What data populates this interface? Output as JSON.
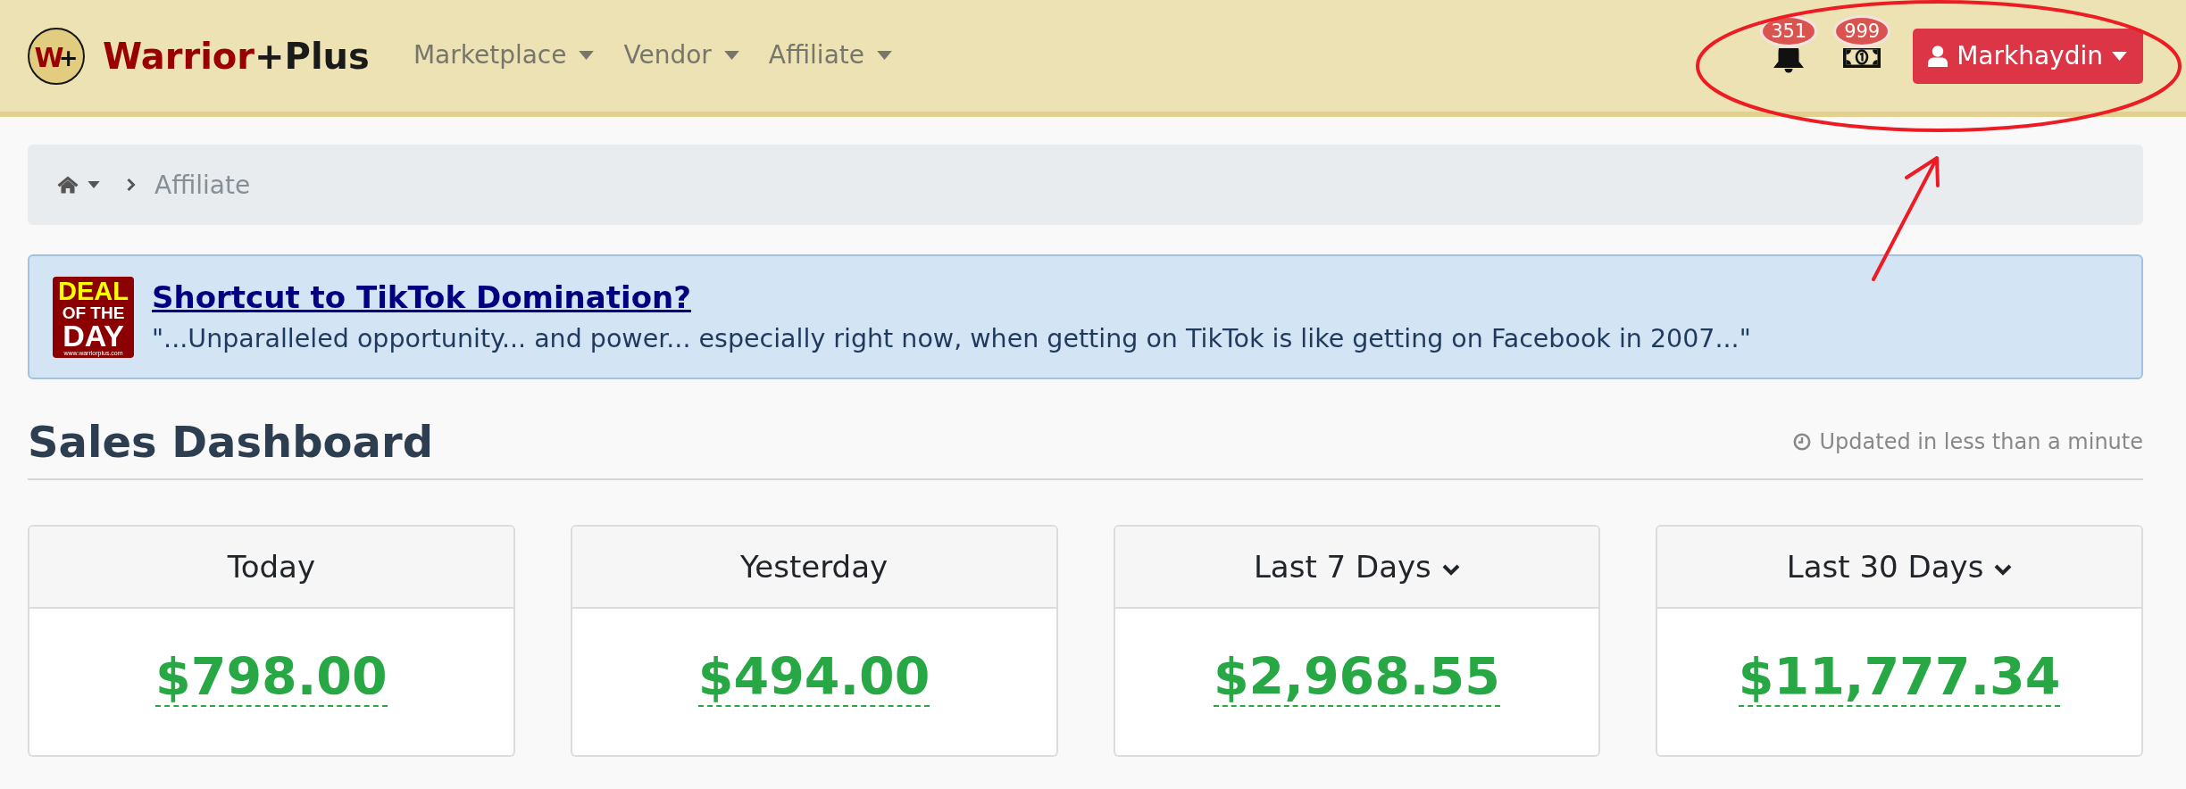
{
  "header": {
    "logo": {
      "mark": [
        "W",
        "+"
      ],
      "name": [
        "Warrior",
        "+Plus"
      ]
    },
    "nav": [
      {
        "label": "Marketplace"
      },
      {
        "label": "Vendor"
      },
      {
        "label": "Affiliate"
      }
    ],
    "notifications": [
      {
        "kind": "bell",
        "count": "351"
      },
      {
        "kind": "money",
        "count": "999"
      }
    ],
    "user_menu": {
      "label": "Markhaydin"
    }
  },
  "breadcrumb": {
    "current": "Affiliate"
  },
  "deal": {
    "badge": {
      "lines": [
        "DEAL",
        "OF THE",
        "DAY"
      ],
      "url": "www.warriorplus.com"
    },
    "title": "Shortcut to TikTok Domination?",
    "quote": "\"...Unparalleled opportunity... and power... especially right now, when getting on TikTok is like getting on Facebook in 2007...\""
  },
  "dashboard": {
    "title": "Sales Dashboard",
    "updated": "Updated in less than a minute",
    "cards": [
      {
        "label": "Today",
        "amount": "$798.00",
        "has_menu": false
      },
      {
        "label": "Yesterday",
        "amount": "$494.00",
        "has_menu": false
      },
      {
        "label": "Last 7 Days",
        "amount": "$2,968.55",
        "has_menu": true
      },
      {
        "label": "Last 30 Days",
        "amount": "$11,777.34",
        "has_menu": true
      }
    ]
  },
  "annotation": {
    "ellipse": true,
    "arrow": true
  }
}
